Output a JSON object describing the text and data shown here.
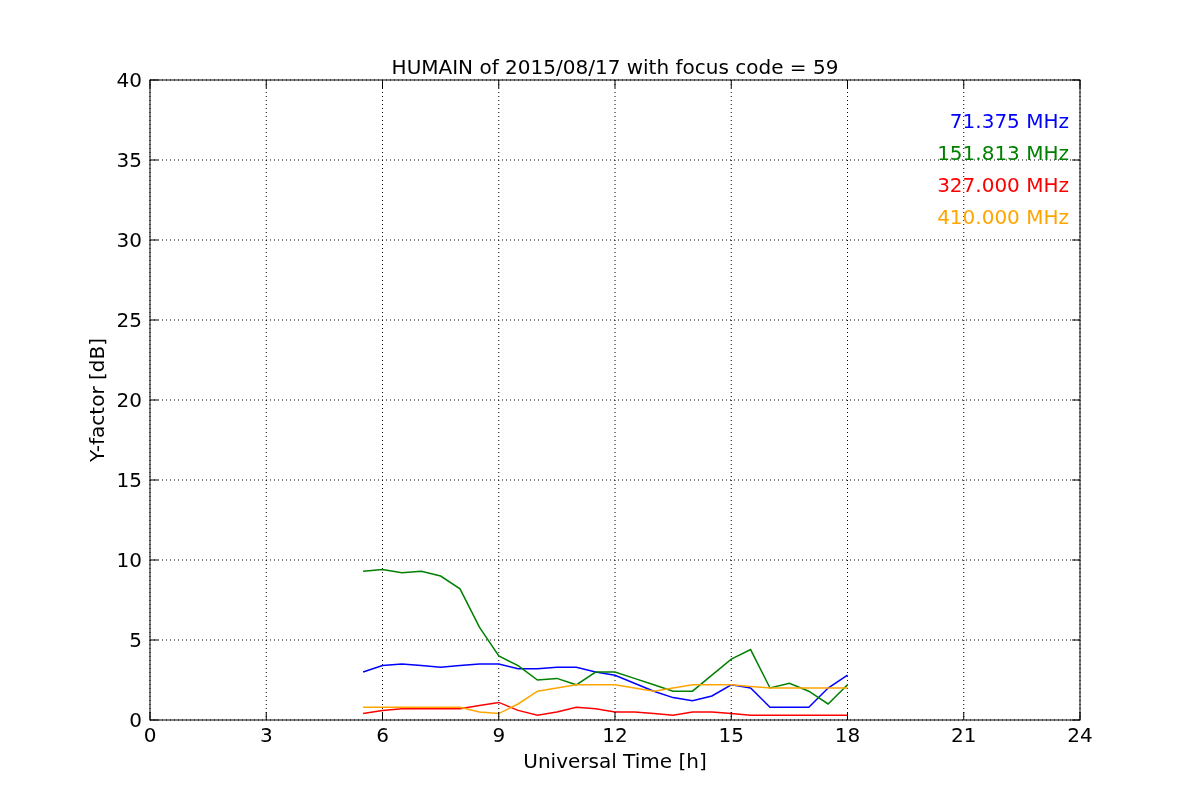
{
  "chart_data": {
    "type": "line",
    "title": "HUMAIN of 2015/08/17 with focus code = 59",
    "xlabel": "Universal Time [h]",
    "ylabel": "Y-factor [dB]",
    "x": [
      5.5,
      6,
      6.5,
      7,
      7.5,
      8,
      8.5,
      9,
      9.5,
      10,
      10.5,
      11,
      11.5,
      12,
      12.5,
      13,
      13.5,
      14,
      14.5,
      15,
      15.5,
      16,
      16.5,
      17,
      17.5,
      18
    ],
    "series": [
      {
        "name": "71.375 MHz",
        "color": "#0000ff",
        "values": [
          3.0,
          3.4,
          3.5,
          3.4,
          3.3,
          3.4,
          3.5,
          3.5,
          3.2,
          3.2,
          3.3,
          3.3,
          3.0,
          2.8,
          2.3,
          1.8,
          1.4,
          1.2,
          1.5,
          2.2,
          2.0,
          0.8,
          0.8,
          0.8,
          2.0,
          2.8
        ]
      },
      {
        "name": "151.813 MHz",
        "color": "#008000",
        "values": [
          9.3,
          9.4,
          9.2,
          9.3,
          9.0,
          8.2,
          5.8,
          4.0,
          3.4,
          2.5,
          2.6,
          2.2,
          3.0,
          3.0,
          2.6,
          2.2,
          1.8,
          1.8,
          2.8,
          3.8,
          4.4,
          2.0,
          2.3,
          1.8,
          1.0,
          2.2
        ]
      },
      {
        "name": "327.000 MHz",
        "color": "#ff0000",
        "values": [
          0.4,
          0.6,
          0.7,
          0.7,
          0.7,
          0.7,
          0.9,
          1.1,
          0.6,
          0.3,
          0.5,
          0.8,
          0.7,
          0.5,
          0.5,
          0.4,
          0.3,
          0.5,
          0.5,
          0.4,
          0.3,
          0.3,
          0.3,
          0.3,
          0.3,
          0.3
        ]
      },
      {
        "name": "410.000 MHz",
        "color": "#ffa500",
        "values": [
          0.8,
          0.8,
          0.8,
          0.8,
          0.8,
          0.8,
          0.5,
          0.4,
          1.0,
          1.8,
          2.0,
          2.2,
          2.2,
          2.2,
          2.0,
          1.8,
          2.0,
          2.2,
          2.2,
          2.2,
          2.1,
          2.0,
          2.0,
          2.0,
          2.0,
          2.0
        ]
      }
    ],
    "grid": true,
    "xlim": [
      0,
      24
    ],
    "ylim": [
      0,
      40
    ],
    "xticks": [
      0,
      3,
      6,
      9,
      12,
      15,
      18,
      21,
      24
    ],
    "yticks": [
      0,
      5,
      10,
      15,
      20,
      25,
      30,
      35,
      40
    ]
  }
}
